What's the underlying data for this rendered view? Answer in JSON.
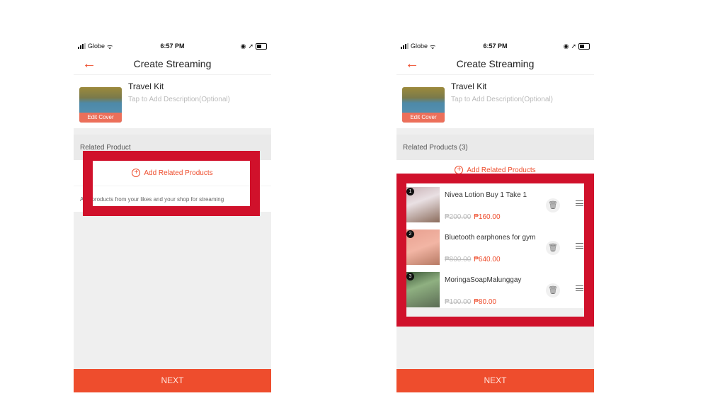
{
  "status_bar": {
    "carrier": "Globe",
    "time": "6:57 PM"
  },
  "header": {
    "title": "Create Streaming",
    "back_icon": "arrow-left-icon"
  },
  "stream": {
    "title": "Travel Kit",
    "description_placeholder": "Tap to Add Description(Optional)",
    "edit_cover_label": "Edit Cover"
  },
  "left_screen": {
    "section_header": "Related Product",
    "add_label": "Add Related Products",
    "hint": "Add products from your likes and your shop for streaming"
  },
  "right_screen": {
    "section_header": "Related Products (3)",
    "add_label": "Add Related Products",
    "products": [
      {
        "index": "1",
        "name": "Nivea Lotion Buy 1 Take 1",
        "old_price": "₱200.00",
        "price": "₱160.00"
      },
      {
        "index": "2",
        "name": "Bluetooth earphones for gym",
        "old_price": "₱800.00",
        "price": "₱640.00"
      },
      {
        "index": "3",
        "name": "MoringaSoapMalunggay",
        "old_price": "₱100.00",
        "price": "₱80.00"
      }
    ]
  },
  "next_label": "NEXT",
  "colors": {
    "accent": "#ee4d2d",
    "highlight": "#d0112b"
  }
}
